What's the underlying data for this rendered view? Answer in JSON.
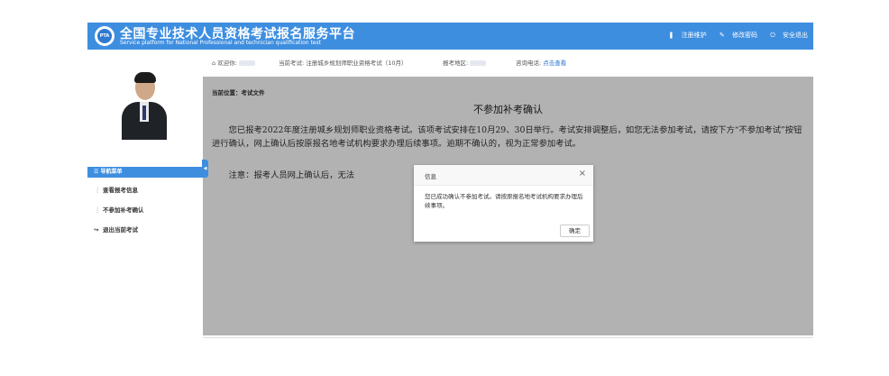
{
  "header": {
    "title_cn": "全国专业技术人员资格考试报名服务平台",
    "title_en": "Service platform for National Professional and technician qualification test",
    "logo_text": "PTA",
    "links": [
      "注册维护",
      "修改密码",
      "安全退出"
    ]
  },
  "sidebar": {
    "nav_title": "导航菜单",
    "items": [
      {
        "icon": "info-icon",
        "label": "查看报考信息"
      },
      {
        "icon": "info-icon",
        "label": "不参加补考确认"
      },
      {
        "icon": "logout-icon",
        "label": "退出当前考试"
      }
    ]
  },
  "infobar": {
    "welcome_label": "欢迎你:",
    "current_exam_label": "当前考试:",
    "current_exam_value": "注册城乡规划师职业资格考试（10月）",
    "region_label": "报考地区:",
    "phone_label": "咨询电话:",
    "phone_link": "点击查看"
  },
  "breadcrumb": "当前位置：考试文件",
  "document": {
    "title": "不参加补考确认",
    "para1": "您已报考2022年度注册城乡规划师职业资格考试。该项考试安排在10月29、30日举行。考试安排调整后，如您无法参加考试，请按下方“不参加考试”按钮进行确认，网上确认后按原报名地考试机构要求办理后续事项。逾期不确认的，视为正常参加考试。",
    "para2": "注意：报考人员网上确认后，无法"
  },
  "dialog": {
    "title": "信息",
    "close": "×",
    "message": "您已成功确认不参加考试。请按原报名地考试机构要求办理后续事项。",
    "ok_label": "确定"
  },
  "colors": {
    "accent": "#3e8ee0",
    "link": "#2a6fd1",
    "mask": "rgba(0,0,0,0.3)"
  }
}
